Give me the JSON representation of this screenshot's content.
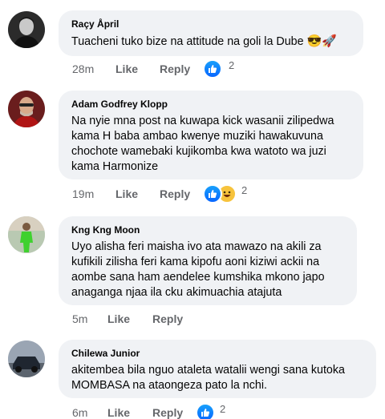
{
  "comments": [
    {
      "author": "Raçy Åpril",
      "text": "Tuacheni tuko bize na attitude na goli la Dube",
      "emoji": "😎🚀",
      "time": "28m",
      "like_label": "Like",
      "reply_label": "Reply",
      "reaction_count": "2",
      "reactions": [
        "like-icon"
      ]
    },
    {
      "author": "Adam Godfrey Klopp",
      "text": "Na nyie mna post na kuwapa kick wasanii zilipedwa kama H baba ambao kwenye muziki hawakuvuna chochote wamebaki kujikomba kwa watoto wa juzi kama Harmonize",
      "time": "19m",
      "like_label": "Like",
      "reply_label": "Reply",
      "reaction_count": "2",
      "reactions": [
        "like-icon",
        "haha-icon"
      ]
    },
    {
      "author": "Kng Kng Moon",
      "text": "Uyo alisha feri maisha ivo ata mawazo na akili za kufikili zilisha feri kama kipofu aoni kiziwi ackii na aombe sana ham aendelee kumshika mkono japo anaganga njaa ila cku akimuachia atajuta",
      "time": "5m",
      "like_label": "Like",
      "reply_label": "Reply"
    },
    {
      "author": "Chilewa Junior",
      "text": "akitembea bila nguo ataleta watalii wengi sana kutoka MOMBASA na ataongeza pato la nchi.",
      "time": "6m",
      "like_label": "Like",
      "reply_label": "Reply",
      "reaction_count": "2",
      "reactions": [
        "like-icon"
      ]
    }
  ],
  "colors": {
    "bubble": "#f0f2f5",
    "meta_text": "#65676b",
    "like_blue": "#0866ff",
    "haha_yellow": "#f7c33c"
  }
}
